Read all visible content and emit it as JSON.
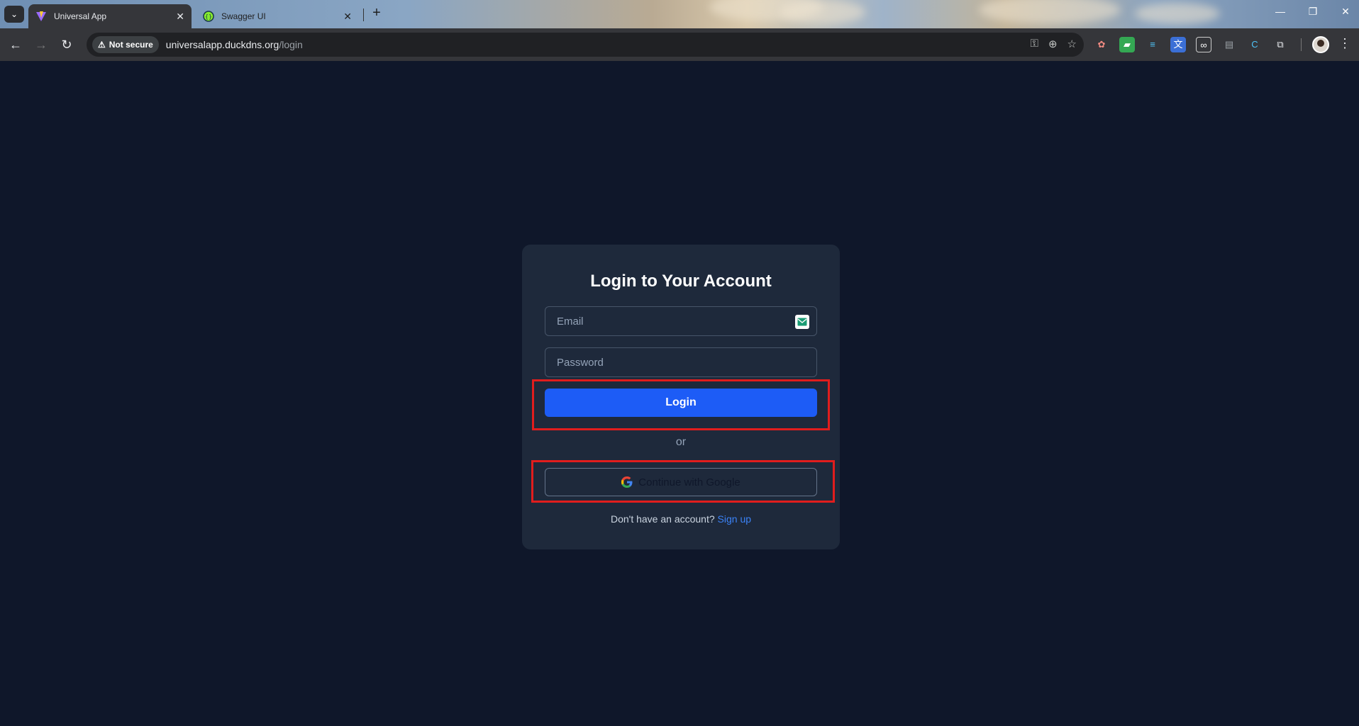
{
  "browser": {
    "tabs": [
      {
        "title": "Universal App",
        "active": true
      },
      {
        "title": "Swagger UI",
        "active": false
      }
    ],
    "security_label": "Not secure",
    "url_host": "universalapp.duckdns.org",
    "url_path": "/login"
  },
  "login": {
    "title": "Login to Your Account",
    "email_placeholder": "Email",
    "password_placeholder": "Password",
    "login_label": "Login",
    "divider": "or",
    "google_label": "Continue with Google",
    "signup_prompt": "Don't have an account?",
    "signup_link": "Sign up"
  },
  "colors": {
    "page_bg": "#0f172a",
    "card_bg": "#1e293b",
    "primary": "#1d5cf6",
    "link": "#3b82f6",
    "highlight": "#e11d1d"
  }
}
